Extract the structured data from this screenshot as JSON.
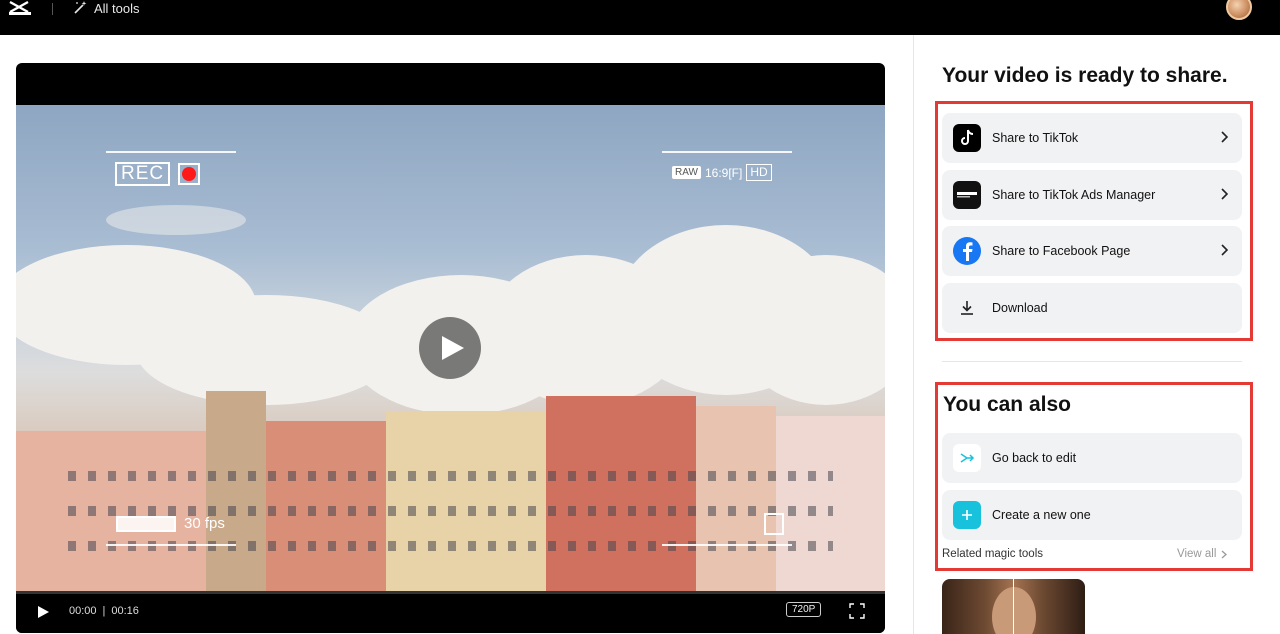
{
  "topbar": {
    "logo_icon": "capcut-logo-icon",
    "all_tools_label": "All tools",
    "all_tools_icon": "magic-wand-icon"
  },
  "video": {
    "overlay": {
      "rec_label": "REC",
      "raw_label": "RAW",
      "aspect_label": "16:9[F]",
      "hd_label": "HD",
      "fps_label": "30 fps"
    },
    "current_time": "00:00",
    "separator": "|",
    "duration": "00:16",
    "progress": 0,
    "quality": "720P"
  },
  "share": {
    "title": "Your video is ready to share.",
    "items": [
      {
        "label": "Share to TikTok",
        "icon": "tiktok-icon"
      },
      {
        "label": "Share to TikTok Ads Manager",
        "icon": "tiktok-business-icon"
      },
      {
        "label": "Share to Facebook Page",
        "icon": "facebook-icon"
      },
      {
        "label": "Download",
        "icon": "download-icon"
      }
    ]
  },
  "also": {
    "title": "You can also",
    "items": [
      {
        "label": "Go back to edit",
        "icon": "edit-icon"
      },
      {
        "label": "Create a new one",
        "icon": "plus-icon"
      }
    ],
    "related_label": "Related magic tools",
    "view_all_label": "View all"
  },
  "colors": {
    "highlight_border": "#e53935",
    "facebook": "#1877f2",
    "accent_cyan": "#19c2dc"
  }
}
